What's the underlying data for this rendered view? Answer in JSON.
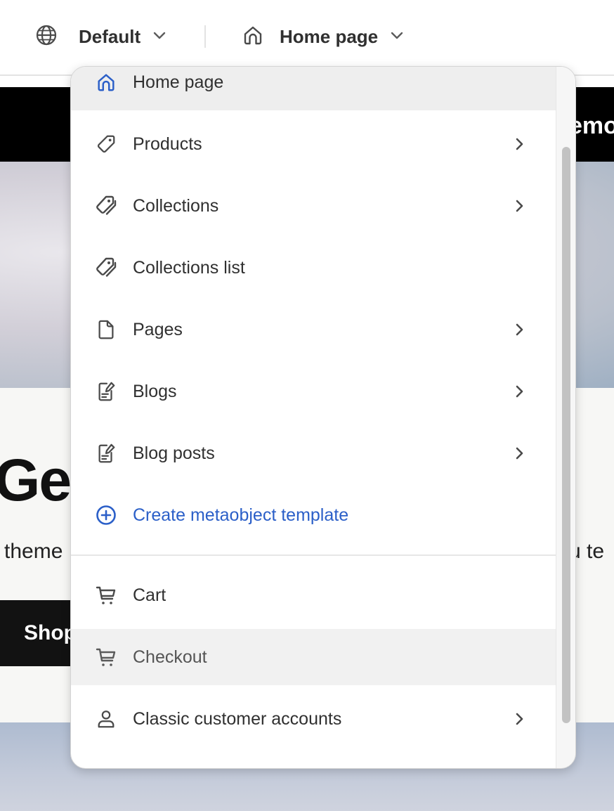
{
  "topbar": {
    "language": {
      "label": "Default",
      "icon": "globe-icon"
    },
    "template": {
      "label": "Home page",
      "icon": "home-icon"
    }
  },
  "preview": {
    "announcement": "emo",
    "hero_title": "Gen",
    "hero_subtitle_left": "theme",
    "hero_subtitle_right": "u te",
    "hero_button": "Shop"
  },
  "menu": {
    "items": [
      {
        "label": "Home page",
        "icon": "home-icon",
        "submenu": false,
        "state": "selected"
      },
      {
        "label": "Products",
        "icon": "tag-icon",
        "submenu": true
      },
      {
        "label": "Collections",
        "icon": "tags-icon",
        "submenu": true
      },
      {
        "label": "Collections list",
        "icon": "tags-icon",
        "submenu": false
      },
      {
        "label": "Pages",
        "icon": "page-icon",
        "submenu": true
      },
      {
        "label": "Blogs",
        "icon": "blog-icon",
        "submenu": true
      },
      {
        "label": "Blog posts",
        "icon": "blog-icon",
        "submenu": true
      },
      {
        "label": "Create metaobject template",
        "icon": "plus-circle-icon",
        "submenu": false,
        "state": "link"
      },
      {
        "label": "Cart",
        "icon": "cart-icon",
        "submenu": false
      },
      {
        "label": "Checkout",
        "icon": "cart-icon",
        "submenu": false,
        "state": "hovered"
      },
      {
        "label": "Classic customer accounts",
        "icon": "person-icon",
        "submenu": true
      }
    ]
  },
  "colors": {
    "link_blue": "#2b5fc8",
    "selected_bg": "#eeeeee",
    "text": "#303030"
  }
}
